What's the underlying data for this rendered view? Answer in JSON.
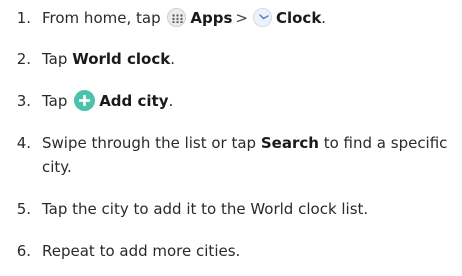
{
  "steps": [
    {
      "num": "1.",
      "t1": "From home, tap",
      "apps": "Apps",
      "sep": ">",
      "clock": "Clock",
      "end": "."
    },
    {
      "num": "2.",
      "pre": "Tap",
      "bold": "World clock",
      "end": "."
    },
    {
      "num": "3.",
      "pre": "Tap",
      "bold": "Add city",
      "end": "."
    },
    {
      "num": "4.",
      "pre": "Swipe through the list or tap",
      "bold": "Search",
      "post": "to find a specific city."
    },
    {
      "num": "5.",
      "text": "Tap the city to add it to the World clock list."
    },
    {
      "num": "6.",
      "text": "Repeat to add more cities."
    }
  ],
  "icons": {
    "apps": "apps-grid-icon",
    "clock": "clock-app-icon",
    "add": "add-circle-icon"
  },
  "colors": {
    "add_accent": "#4cc1ac",
    "text": "#2a2a2a"
  }
}
